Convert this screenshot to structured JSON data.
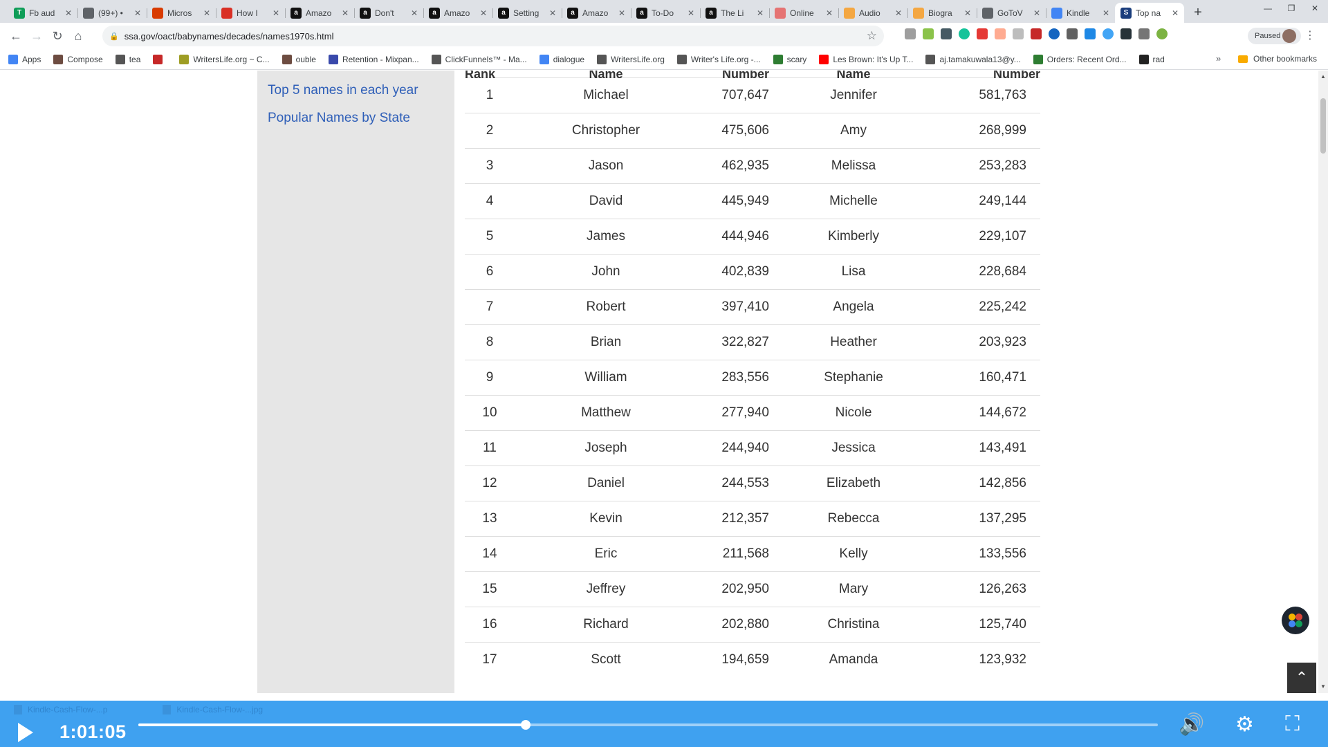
{
  "browser": {
    "tabs": [
      {
        "title": "Fb aud",
        "color": "#0f9d58",
        "glyph": "T"
      },
      {
        "title": "(99+) •",
        "color": "#5f6368",
        "glyph": ""
      },
      {
        "title": "Micros",
        "color": "#d83b01",
        "glyph": ""
      },
      {
        "title": "How I",
        "color": "#d93025",
        "glyph": ""
      },
      {
        "title": "Amazo",
        "color": "#111111",
        "glyph": "a"
      },
      {
        "title": "Don't",
        "color": "#111111",
        "glyph": "a"
      },
      {
        "title": "Amazo",
        "color": "#111111",
        "glyph": "a"
      },
      {
        "title": "Setting",
        "color": "#111111",
        "glyph": "a"
      },
      {
        "title": "Amazo",
        "color": "#111111",
        "glyph": "a"
      },
      {
        "title": "To-Do",
        "color": "#111111",
        "glyph": "a"
      },
      {
        "title": "The Li",
        "color": "#111111",
        "glyph": "a"
      },
      {
        "title": "Online",
        "color": "#e57373",
        "glyph": ""
      },
      {
        "title": "Audio",
        "color": "#f4a742",
        "glyph": ""
      },
      {
        "title": "Biogra",
        "color": "#f4a742",
        "glyph": ""
      },
      {
        "title": "GoToV",
        "color": "#5f6368",
        "glyph": ""
      },
      {
        "title": "Kindle",
        "color": "#4285f4",
        "glyph": ""
      },
      {
        "title": "Top na",
        "color": "#1a3d7c",
        "glyph": "S",
        "active": true
      }
    ],
    "url": "ssa.gov/oact/babynames/decades/names1970s.html",
    "profile_status": "Paused",
    "bookmarks": [
      {
        "label": "Apps",
        "color": "#4285f4"
      },
      {
        "label": "Compose",
        "color": "#6d4c41"
      },
      {
        "label": "tea",
        "color": "#555555"
      },
      {
        "label": "",
        "color": "#c62828"
      },
      {
        "label": "WritersLife.org ~ C...",
        "color": "#9e9d24"
      },
      {
        "label": "ouble",
        "color": "#6d4c41"
      },
      {
        "label": "Retention - Mixpan...",
        "color": "#3949ab"
      },
      {
        "label": "ClickFunnels™ - Ma...",
        "color": "#555555"
      },
      {
        "label": "dialogue",
        "color": "#4285f4"
      },
      {
        "label": "WritersLife.org",
        "color": "#555555"
      },
      {
        "label": "Writer's Life.org -...",
        "color": "#555555"
      },
      {
        "label": "scary",
        "color": "#2e7d32"
      },
      {
        "label": "Les Brown: It's Up T...",
        "color": "#ff0000"
      },
      {
        "label": "aj.tamakuwala13@y...",
        "color": "#555555"
      },
      {
        "label": "Orders: Recent Ord...",
        "color": "#2e7d32"
      },
      {
        "label": "rad",
        "color": "#222222"
      }
    ],
    "bookmarks_more": "»",
    "other_bookmarks": "Other bookmarks"
  },
  "sidebar": {
    "links": [
      "Top 5 names in each year",
      "Popular Names by State"
    ]
  },
  "table": {
    "headers": [
      "Rank",
      "Name",
      "Number",
      "Name",
      "Number"
    ],
    "rows": [
      [
        "1",
        "Michael",
        "707,647",
        "Jennifer",
        "581,763"
      ],
      [
        "2",
        "Christopher",
        "475,606",
        "Amy",
        "268,999"
      ],
      [
        "3",
        "Jason",
        "462,935",
        "Melissa",
        "253,283"
      ],
      [
        "4",
        "David",
        "445,949",
        "Michelle",
        "249,144"
      ],
      [
        "5",
        "James",
        "444,946",
        "Kimberly",
        "229,107"
      ],
      [
        "6",
        "John",
        "402,839",
        "Lisa",
        "228,684"
      ],
      [
        "7",
        "Robert",
        "397,410",
        "Angela",
        "225,242"
      ],
      [
        "8",
        "Brian",
        "322,827",
        "Heather",
        "203,923"
      ],
      [
        "9",
        "William",
        "283,556",
        "Stephanie",
        "160,471"
      ],
      [
        "10",
        "Matthew",
        "277,940",
        "Nicole",
        "144,672"
      ],
      [
        "11",
        "Joseph",
        "244,940",
        "Jessica",
        "143,491"
      ],
      [
        "12",
        "Daniel",
        "244,553",
        "Elizabeth",
        "142,856"
      ],
      [
        "13",
        "Kevin",
        "212,357",
        "Rebecca",
        "137,295"
      ],
      [
        "14",
        "Eric",
        "211,568",
        "Kelly",
        "133,556"
      ],
      [
        "15",
        "Jeffrey",
        "202,950",
        "Mary",
        "126,263"
      ],
      [
        "16",
        "Richard",
        "202,880",
        "Christina",
        "125,740"
      ],
      [
        "17",
        "Scott",
        "194,659",
        "Amanda",
        "123,932"
      ]
    ]
  },
  "downloads": [
    "Kindle-Cash-Flow-...p",
    "Kindle-Cash-Flow-...jpg"
  ],
  "player": {
    "timecode": "1:01:05",
    "progress": 0.38,
    "accent": "#3fa1f0"
  }
}
